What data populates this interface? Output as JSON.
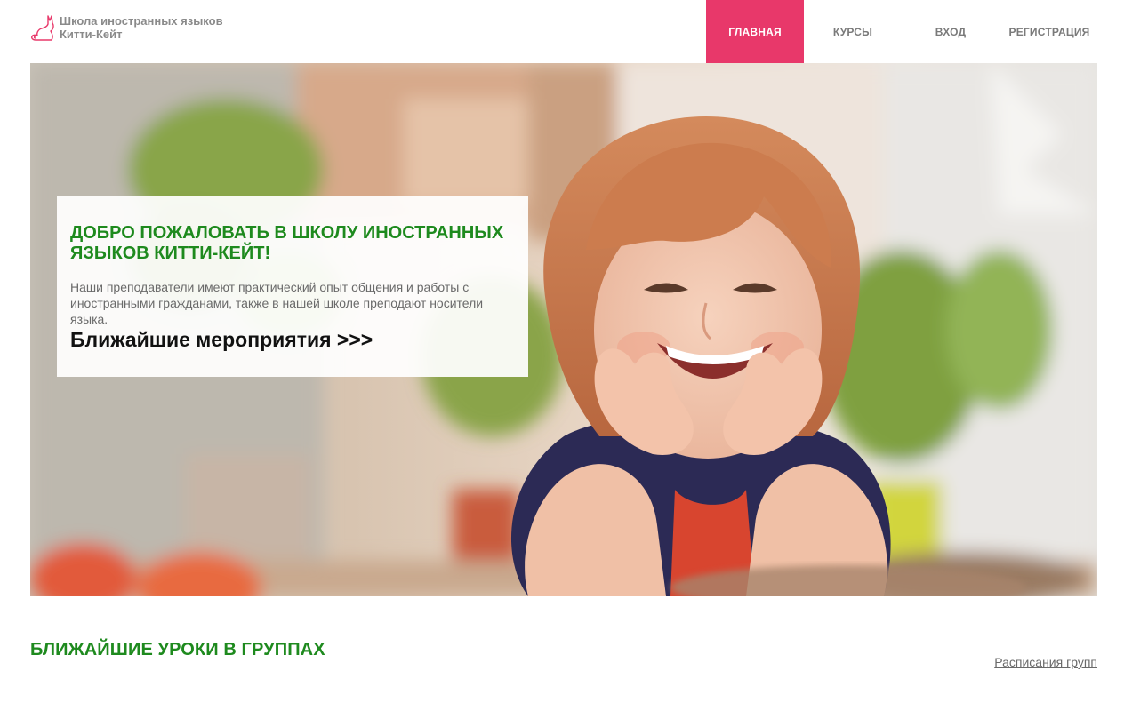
{
  "header": {
    "logo": {
      "icon": "cat-icon",
      "line1": "Школа иностранных языков",
      "line2": "Китти-Кейт"
    },
    "nav": [
      {
        "label": "ГЛАВНАЯ",
        "active": true
      },
      {
        "label": "КУРСЫ",
        "active": false
      },
      {
        "label": "ВХОД",
        "active": false
      },
      {
        "label": "РЕГИСТРАЦИЯ",
        "active": false
      }
    ]
  },
  "hero": {
    "image": "smiling-girl-photo",
    "title": "ДОБРО ПОЖАЛОВАТЬ В ШКОЛУ ИНОСТРАННЫХ ЯЗЫКОВ КИТТИ-КЕЙТ!",
    "text": "Наши преподаватели имеют практический опыт общения и работы с иностранными гражданами, также в нашей школе преподают носители языка.",
    "events_link": "Ближайшие мероприятия >>>"
  },
  "lessons": {
    "title": "БЛИЖАЙШИЕ УРОКИ В ГРУППАХ",
    "schedule_link": "Расписания групп"
  },
  "colors": {
    "accent": "#e8386a",
    "green": "#1e8a1e"
  }
}
